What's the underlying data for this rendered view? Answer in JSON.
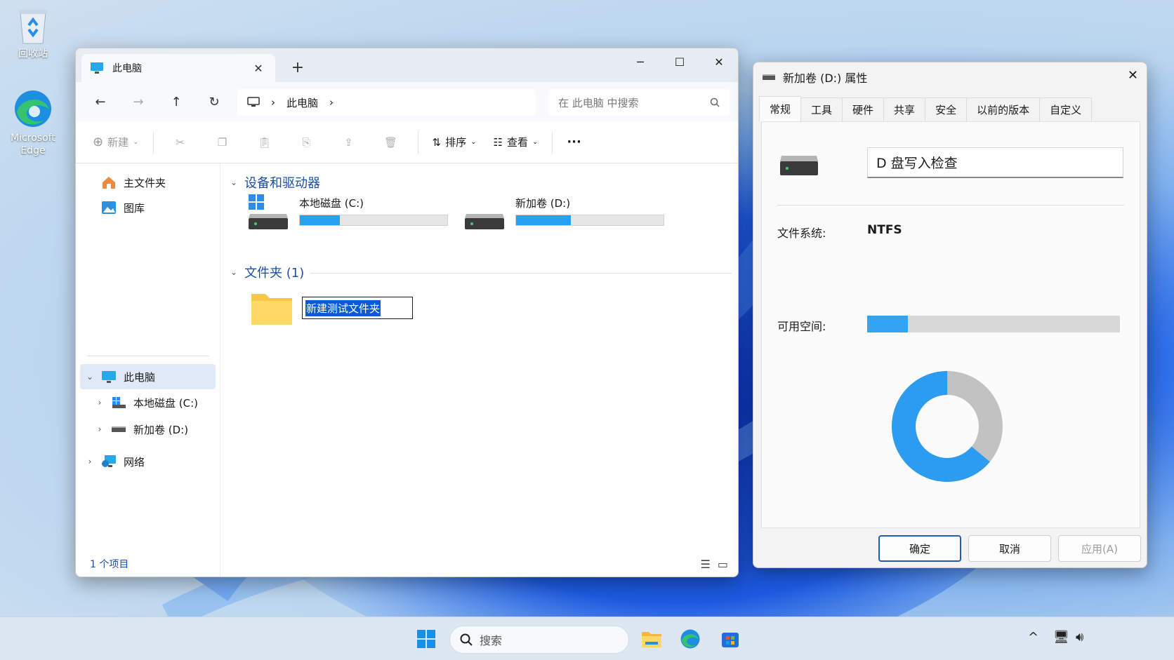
{
  "desktop": {
    "recycle_bin_label": "回收站",
    "edge_label_1": "Microsoft",
    "edge_label_2": "Edge"
  },
  "explorer": {
    "tab_title": "此电脑",
    "close_tab": "✕",
    "new_tab": "+",
    "minimize": "─",
    "maximize": "☐",
    "close": "✕",
    "breadcrumb_current": "此电脑",
    "search_placeholder": "在 此电脑 中搜索",
    "toolbar": {
      "new_label": "新建",
      "sort_label": "排序",
      "view_label": "查看",
      "more_label": "···"
    },
    "sidebar": {
      "home": "主文件夹",
      "gallery": "图库",
      "this_pc": "此电脑",
      "drive_c": "本地磁盘 (C:)",
      "drive_d": "新加卷 (D:)",
      "network": "网络"
    },
    "sections": {
      "devices": "设备和驱动器",
      "folders": "文件夹 (1)"
    },
    "drives": [
      {
        "name": "本地磁盘 (C:)",
        "used_fraction": 0.27
      },
      {
        "name": "新加卷 (D:)",
        "used_fraction": 0.37
      }
    ],
    "rename_value": "新建测试文件夹",
    "status": "1 个项目"
  },
  "properties": {
    "title": "新加卷 (D:) 属性",
    "close": "✕",
    "tabs": [
      "常规",
      "工具",
      "硬件",
      "共享",
      "安全",
      "以前的版本",
      "自定义"
    ],
    "volume_label_value": "D 盘写入检查",
    "filesystem_label": "文件系统:",
    "filesystem_value": "NTFS",
    "free_space_label": "可用空间:",
    "free_space_fraction": 0.16,
    "pie_used_fraction": 0.64,
    "buttons": {
      "ok": "确定",
      "cancel": "取消",
      "apply": "应用(A)"
    },
    "colors": {
      "used": "#2b9cf0",
      "free": "#c2c2c2"
    }
  },
  "taskbar": {
    "search_placeholder": "搜索",
    "tray_chevron": "^"
  }
}
